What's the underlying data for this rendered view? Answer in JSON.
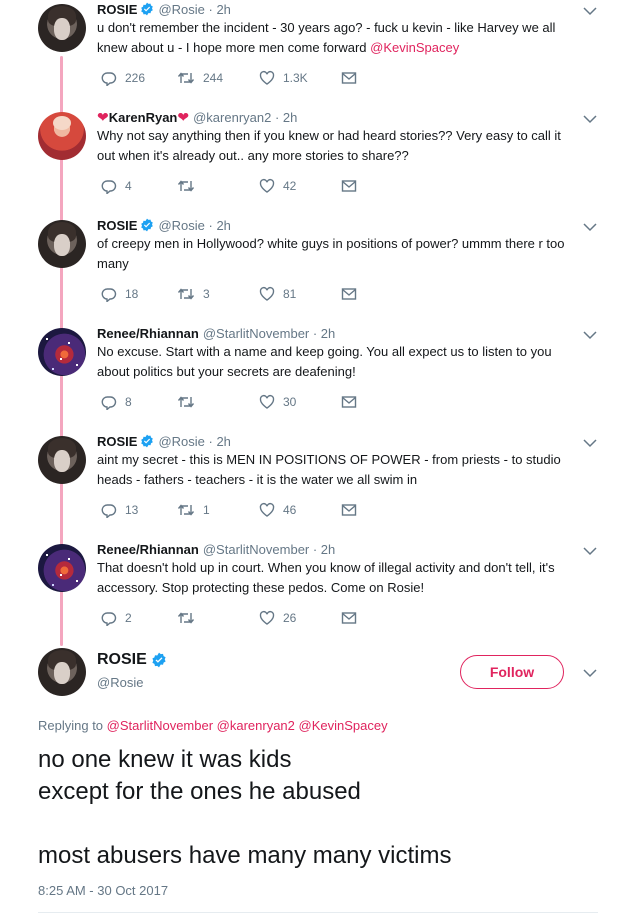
{
  "tweets": [
    {
      "name": "ROSIE",
      "handle": "@Rosie · 2h",
      "text": "u don't remember the incident - 30 years ago? - fuck u kevin - like Harvey we all knew about u - I hope more men come forward ",
      "mention": "@KevinSpacey",
      "replies": "226",
      "retweets": "244",
      "likes": "1.3K",
      "verified": true
    },
    {
      "name": "KarenRyan",
      "handle": "@karenryan2 · 2h",
      "text": "Why not say anything then if you knew or had heard stories?? Very easy to call it out when it's already out.. any more stories to share??",
      "replies": "4",
      "retweets": "",
      "likes": "42",
      "name_prefix": "❤",
      "name_suffix": "❤"
    },
    {
      "name": "ROSIE",
      "handle": "@Rosie · 2h",
      "text": "of creepy men in Hollywood? white guys in positions of power? ummm there r too many",
      "replies": "18",
      "retweets": "3",
      "likes": "81",
      "verified": true
    },
    {
      "name": "Renee/Rhiannan",
      "handle": "@StarlitNovember · 2h",
      "text": "No excuse. Start with a name and keep going. You all expect us to listen to you about politics but your secrets are deafening!",
      "replies": "8",
      "retweets": "",
      "likes": "30"
    },
    {
      "name": "ROSIE",
      "handle": "@Rosie · 2h",
      "text": "aint my secret - this is MEN IN POSITIONS OF POWER - from priests - to studio heads - fathers - teachers - it is the water we all swim in",
      "replies": "13",
      "retweets": "1",
      "likes": "46",
      "verified": true
    },
    {
      "name": "Renee/Rhiannan",
      "handle": "@StarlitNovember · 2h",
      "text": "That doesn't hold up in court. When you know of illegal activity and don't tell, it's accessory. Stop protecting these pedos. Come on Rosie!",
      "replies": "2",
      "retweets": "",
      "likes": "26"
    }
  ],
  "main": {
    "name": "ROSIE",
    "handle": "@Rosie",
    "follow_label": "Follow",
    "replying_prefix": "Replying to ",
    "replying_to": "@StarlitNovember @karenryan2 @KevinSpacey",
    "lines": [
      "no one knew it was kids",
      "except for the ones he abused",
      "most abusers have many many victims"
    ],
    "timestamp": "8:25 AM - 30 Oct 2017"
  },
  "colors": {
    "accent": "#e0245e",
    "thread_line": "#f4a6bf",
    "muted": "#657786",
    "verified": "#1da1f2"
  },
  "icons": {
    "reply": "reply-icon",
    "retweet": "retweet-icon",
    "like": "heart-icon",
    "dm": "envelope-icon",
    "verified": "verified-badge-icon",
    "more": "chevron-down-icon"
  }
}
